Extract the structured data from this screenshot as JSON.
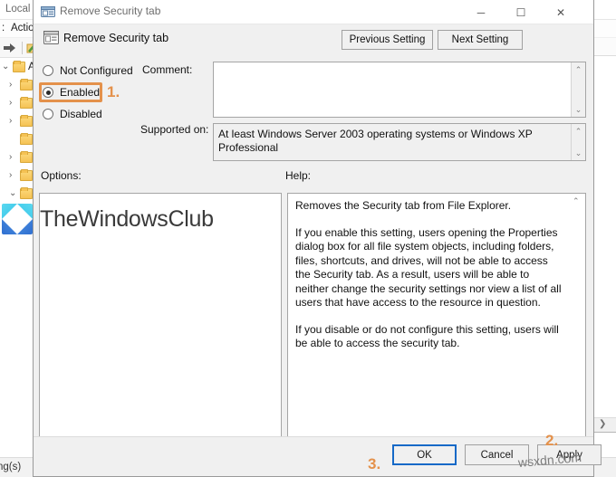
{
  "background_window": {
    "title": "Local Gr",
    "menu": [
      {
        "label": ":"
      },
      {
        "label": "Actio"
      }
    ],
    "toolbar_icons": [
      "forward-arrow-icon",
      "show-hide-tree-icon"
    ],
    "status_text": "tting(s)",
    "tree_items": [
      {
        "chevron": "⌄",
        "label": "A"
      },
      {
        "chevron": "›",
        "label": ""
      },
      {
        "chevron": "›",
        "label": ""
      },
      {
        "chevron": "›",
        "label": ""
      },
      {
        "chevron": "",
        "label": ""
      },
      {
        "chevron": "›",
        "label": ""
      },
      {
        "chevron": "›",
        "label": ""
      },
      {
        "chevron": "⌄",
        "label": ""
      }
    ],
    "right_pane_scroll_arrow": "❯"
  },
  "dialog": {
    "title": "Remove Security tab",
    "title_icon": "policy-setting-icon",
    "window_controls": {
      "minimize": "─",
      "maximize": "☐",
      "close": "✕"
    },
    "setting_name": "Remove Security tab",
    "setting_icon": "policy-setting-icon",
    "previous_setting_label": "Previous Setting",
    "next_setting_label": "Next Setting",
    "state_options": [
      {
        "label": "Not Configured",
        "selected": false
      },
      {
        "label": "Enabled",
        "selected": true
      },
      {
        "label": "Disabled",
        "selected": false
      }
    ],
    "comment_label": "Comment:",
    "comment_value": "",
    "supported_on_label": "Supported on:",
    "supported_on_value": "At least Windows Server 2003 operating systems or Windows XP Professional",
    "options_label": "Options:",
    "options_content": "",
    "help_label": "Help:",
    "help_paragraphs": [
      "Removes the Security tab from File Explorer.",
      "If you enable this setting, users opening the Properties dialog box for all file system objects, including folders, files, shortcuts, and drives, will not be able to access the Security tab. As a result, users will be able to neither change the security settings nor view a list of all users that have access to the resource in question.",
      "If you disable or do not configure this setting, users will be able to access the security tab."
    ],
    "buttons": {
      "ok": "OK",
      "cancel": "Cancel",
      "apply": "Apply"
    },
    "scroll_arrows": {
      "up": "⌃",
      "down": "⌄"
    }
  },
  "annotations": {
    "accent_color": "#E4914B",
    "step_1": "1.",
    "step_2": "2.",
    "step_3": "3."
  },
  "watermarks": {
    "brand": "TheWindowsClub",
    "site": "wsxdn.com"
  }
}
